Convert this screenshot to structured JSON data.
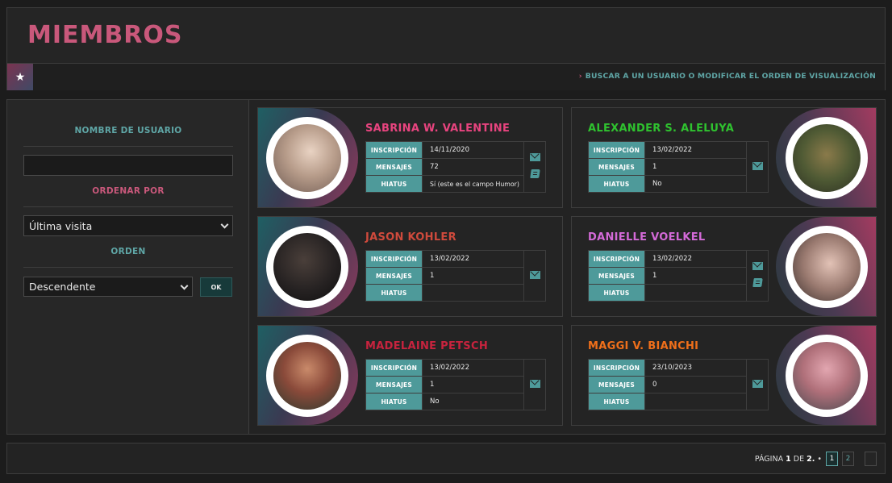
{
  "header": {
    "title": "MIEMBROS",
    "search_link": "BUSCAR A UN USUARIO O MODIFICAR EL ORDEN DE VISUALIZACIÓN",
    "chevron": "›",
    "star_glyph": "★"
  },
  "sidebar": {
    "username_label": "NOMBRE DE USUARIO",
    "username_value": "",
    "order_by_label": "ORDENAR POR",
    "order_by_selected": "Última visita",
    "order_label": "ORDEN",
    "order_selected": "Descendente",
    "ok_label": "OK"
  },
  "field_labels": {
    "inscripcion": "INSCRIPCIÓN",
    "mensajes": "MENSAJES",
    "hiatus": "HIATUS"
  },
  "members": [
    {
      "name": "SABRINA W. VALENTINE",
      "color": "#e8447f",
      "inscripcion": "14/11/2020",
      "mensajes": "72",
      "hiatus": "Sí (este es el campo Humor)",
      "has_book": true
    },
    {
      "name": "ALEXANDER S. ALELUYA",
      "color": "#2fc22f",
      "inscripcion": "13/02/2022",
      "mensajes": "1",
      "hiatus": "No",
      "has_book": false
    },
    {
      "name": "JASON KOHLER",
      "color": "#cf4a3c",
      "inscripcion": "13/02/2022",
      "mensajes": "1",
      "hiatus": "",
      "has_book": false
    },
    {
      "name": "DANIELLE VOELKEL",
      "color": "#d46ad8",
      "inscripcion": "13/02/2022",
      "mensajes": "1",
      "hiatus": "",
      "has_book": true
    },
    {
      "name": "MADELAINE PETSCH",
      "color": "#c8233e",
      "inscripcion": "13/02/2022",
      "mensajes": "1",
      "hiatus": "No",
      "has_book": false
    },
    {
      "name": "MAGGI V. BIANCHI",
      "color": "#ef6f1a",
      "inscripcion": "23/10/2023",
      "mensajes": "0",
      "hiatus": "",
      "has_book": false
    }
  ],
  "pagination": {
    "prefix": "PÁGINA",
    "current": "1",
    "of": "DE",
    "total": "2.",
    "bullet": "•",
    "pages": [
      "1",
      "2"
    ]
  },
  "colors": {
    "accent_pink": "#c9587b",
    "accent_teal": "#5fa6a6"
  }
}
